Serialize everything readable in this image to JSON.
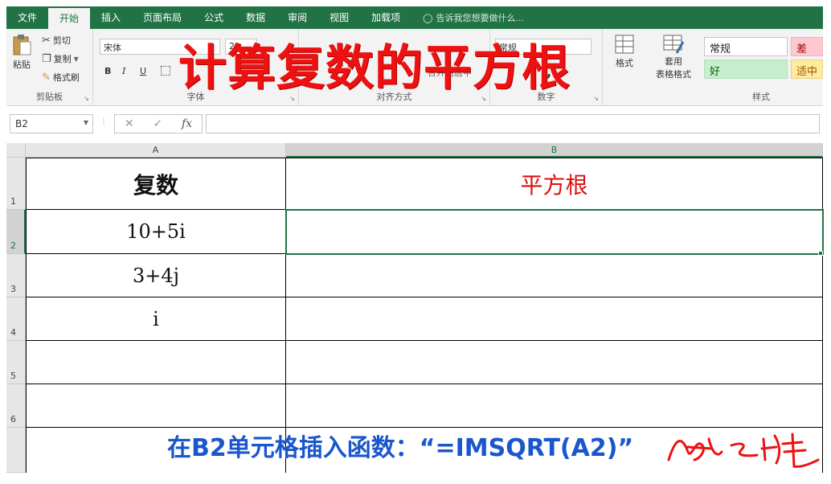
{
  "ribbon_tabs": [
    "文件",
    "开始",
    "插入",
    "页面布局",
    "公式",
    "数据",
    "审阅",
    "视图",
    "加载项"
  ],
  "tell_me": "告诉我您想要做什么...",
  "clipboard": {
    "paste": "粘贴",
    "cut": "剪切",
    "copy": "复制",
    "format_painter": "格式刷",
    "group": "剪贴板"
  },
  "font": {
    "name": "宋体",
    "size": "2",
    "bold": "B",
    "italic": "I",
    "underline": "U",
    "group": "字体"
  },
  "alignment": {
    "merge": "合并后居中",
    "group": "对齐方式"
  },
  "number": {
    "format": "常规",
    "group": "数字",
    "comma": ","
  },
  "styles": {
    "cond_format": "格式",
    "table_format_1": "套用",
    "table_format_2": "表格格式",
    "normal": "常规",
    "bad": "差",
    "good": "好",
    "neutral": "适中",
    "group": "样式"
  },
  "overlay_title": "计算复数的平方根",
  "formula_bar": {
    "name_box": "B2",
    "fx": "fx",
    "cancel": "✕",
    "enter": "✓",
    "content": ""
  },
  "columns": [
    "A",
    "B"
  ],
  "rows": [
    "1",
    "2",
    "3",
    "4",
    "5",
    "6"
  ],
  "cells": {
    "A1": "复数",
    "B1": "平方根",
    "A2": "10+5i",
    "A3": "3+4j",
    "A4": "i"
  },
  "caption": "在B2单元格插入函数：“=IMSQRT(A2)”",
  "colors": {
    "excel_green": "#217346",
    "title_red": "#ee1111",
    "caption_blue": "#1a56cc"
  }
}
